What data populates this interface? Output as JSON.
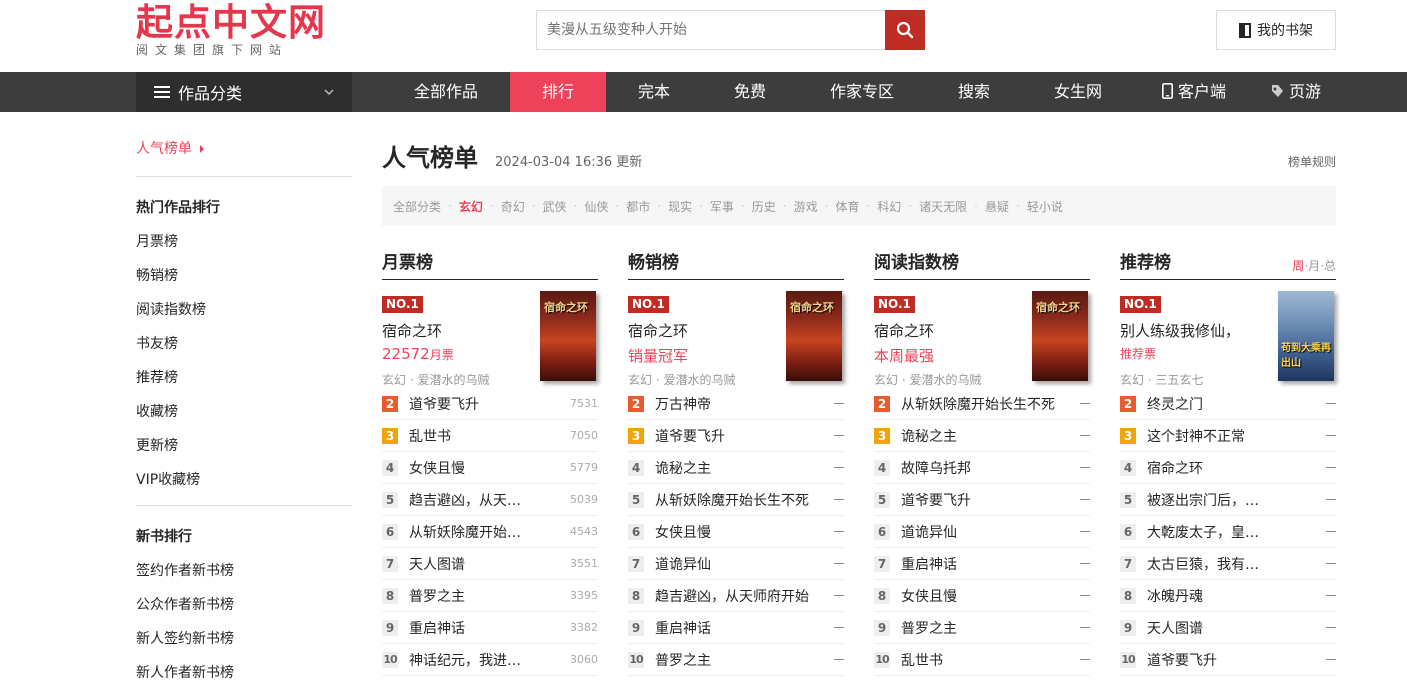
{
  "header": {
    "logo_title": "起点中文网",
    "logo_subtitle": "阅文集团旗下网站",
    "search_placeholder": "美漫从五级变种人开始",
    "shelf_label": "我的书架"
  },
  "nav": {
    "category_label": "作品分类",
    "items": [
      {
        "label": "全部作品",
        "active": false
      },
      {
        "label": "排行",
        "active": true
      },
      {
        "label": "完本",
        "active": false
      },
      {
        "label": "免费",
        "active": false
      },
      {
        "label": "作家专区",
        "active": false
      },
      {
        "label": "搜索",
        "active": false
      },
      {
        "label": "女生网",
        "active": false
      },
      {
        "label": "客户端",
        "active": false
      },
      {
        "label": "页游",
        "active": false
      }
    ]
  },
  "sidebar": {
    "active": "人气榜单",
    "section1": {
      "heading": "热门作品排行",
      "links": [
        "月票榜",
        "畅销榜",
        "阅读指数榜",
        "书友榜",
        "推荐榜",
        "收藏榜",
        "更新榜",
        "VIP收藏榜"
      ]
    },
    "section2": {
      "heading": "新书排行",
      "links": [
        "签约作者新书榜",
        "公众作者新书榜",
        "新人签约新书榜",
        "新人作者新书榜"
      ]
    }
  },
  "main": {
    "title": "人气榜单",
    "update_time": "2024-03-04 16:36 更新",
    "rules_label": "榜单规则",
    "filters": [
      "全部分类",
      "玄幻",
      "奇幻",
      "武侠",
      "仙侠",
      "都市",
      "现实",
      "军事",
      "历史",
      "游戏",
      "体育",
      "科幻",
      "诸天无限",
      "悬疑",
      "轻小说"
    ],
    "active_filter": "玄幻",
    "columns": [
      {
        "title": "月票榜",
        "no1_badge": "NO.1",
        "top_name": "宿命之环",
        "top_stat": "22572",
        "top_stat_unit": "月票",
        "top_meta": "玄幻 · 爱潜水的乌贼",
        "cover_text": "宿命之环",
        "rows": [
          {
            "rank": "2",
            "name": "道爷要飞升",
            "value": "7531"
          },
          {
            "rank": "3",
            "name": "乱世书",
            "value": "7050"
          },
          {
            "rank": "4",
            "name": "女侠且慢",
            "value": "5779"
          },
          {
            "rank": "5",
            "name": "趋吉避凶，从天…",
            "value": "5039"
          },
          {
            "rank": "6",
            "name": "从斩妖除魔开始…",
            "value": "4543"
          },
          {
            "rank": "7",
            "name": "天人图谱",
            "value": "3551"
          },
          {
            "rank": "8",
            "name": "普罗之主",
            "value": "3395"
          },
          {
            "rank": "9",
            "name": "重启神话",
            "value": "3382"
          },
          {
            "rank": "10",
            "name": "神话纪元，我进…",
            "value": "3060"
          }
        ]
      },
      {
        "title": "畅销榜",
        "no1_badge": "NO.1",
        "top_name": "宿命之环",
        "top_stat": "销量冠军",
        "top_stat_unit": "",
        "top_meta": "玄幻 · 爱潜水的乌贼",
        "cover_text": "宿命之环",
        "rows": [
          {
            "rank": "2",
            "name": "万古神帝",
            "value": ""
          },
          {
            "rank": "3",
            "name": "道爷要飞升",
            "value": ""
          },
          {
            "rank": "4",
            "name": "诡秘之主",
            "value": ""
          },
          {
            "rank": "5",
            "name": "从斩妖除魔开始长生不死",
            "value": ""
          },
          {
            "rank": "6",
            "name": "女侠且慢",
            "value": ""
          },
          {
            "rank": "7",
            "name": "道诡异仙",
            "value": ""
          },
          {
            "rank": "8",
            "name": "趋吉避凶，从天师府开始",
            "value": ""
          },
          {
            "rank": "9",
            "name": "重启神话",
            "value": ""
          },
          {
            "rank": "10",
            "name": "普罗之主",
            "value": ""
          }
        ]
      },
      {
        "title": "阅读指数榜",
        "no1_badge": "NO.1",
        "top_name": "宿命之环",
        "top_stat": "本周最强",
        "top_stat_unit": "",
        "top_meta": "玄幻 · 爱潜水的乌贼",
        "cover_text": "宿命之环",
        "rows": [
          {
            "rank": "2",
            "name": "从斩妖除魔开始长生不死",
            "value": ""
          },
          {
            "rank": "3",
            "name": "诡秘之主",
            "value": ""
          },
          {
            "rank": "4",
            "name": "故障乌托邦",
            "value": ""
          },
          {
            "rank": "5",
            "name": "道爷要飞升",
            "value": ""
          },
          {
            "rank": "6",
            "name": "道诡异仙",
            "value": ""
          },
          {
            "rank": "7",
            "name": "重启神话",
            "value": ""
          },
          {
            "rank": "8",
            "name": "女侠且慢",
            "value": ""
          },
          {
            "rank": "9",
            "name": "普罗之主",
            "value": ""
          },
          {
            "rank": "10",
            "name": "乱世书",
            "value": ""
          }
        ]
      },
      {
        "title": "推荐榜",
        "period": [
          "周",
          "月",
          "总"
        ],
        "no1_badge": "NO.1",
        "top_name": "别人练级我修仙，",
        "top_stat": "推荐票",
        "top_stat_unit": "",
        "top_meta": "玄幻 · 三五玄七",
        "cover_text": "苟到大乘再出山",
        "rows": [
          {
            "rank": "2",
            "name": "终灵之门",
            "value": ""
          },
          {
            "rank": "3",
            "name": "这个封神不正常",
            "value": ""
          },
          {
            "rank": "4",
            "name": "宿命之环",
            "value": ""
          },
          {
            "rank": "5",
            "name": "被逐出宗门后，…",
            "value": ""
          },
          {
            "rank": "6",
            "name": "大乾废太子，皇…",
            "value": ""
          },
          {
            "rank": "7",
            "name": "太古巨猿，我有…",
            "value": ""
          },
          {
            "rank": "8",
            "name": "冰魄丹魂",
            "value": ""
          },
          {
            "rank": "9",
            "name": "天人图谱",
            "value": ""
          },
          {
            "rank": "10",
            "name": "道爷要飞升",
            "value": ""
          }
        ]
      }
    ]
  },
  "colors": {
    "brand_red": "#ed4259",
    "logo_red": "#e5374c",
    "search_red": "#bf2c24",
    "nav_bg": "#3d3d3d",
    "rank2": "#e85b2e",
    "rank3": "#f0a30a"
  }
}
